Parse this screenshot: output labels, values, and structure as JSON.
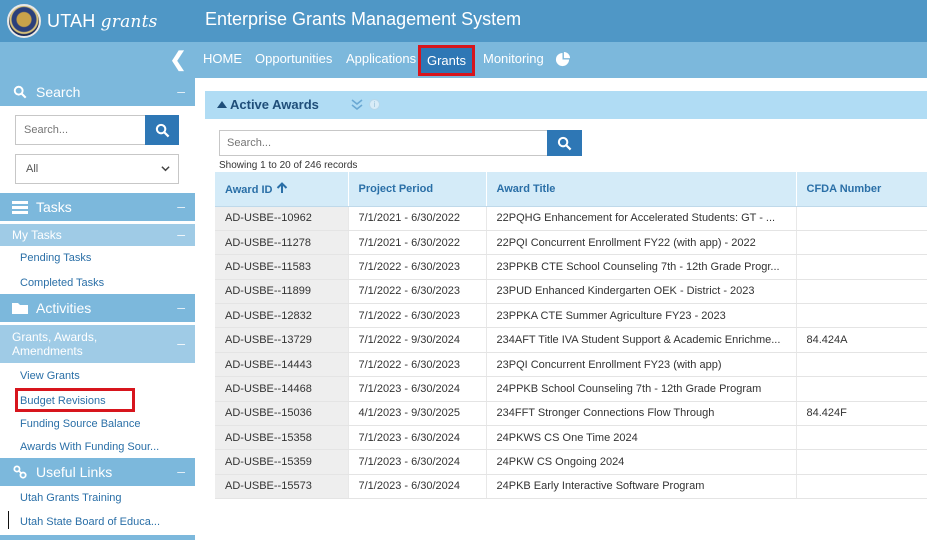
{
  "brand": {
    "logo_text_plain": "UTAH",
    "logo_text_italic": "grants"
  },
  "app_title": "Enterprise Grants Management System",
  "nav": {
    "items": [
      "HOME",
      "Opportunities",
      "Applications",
      "Grants",
      "Monitoring"
    ],
    "active": "Grants"
  },
  "sidebar": {
    "search_title": "Search",
    "search_placeholder": "Search...",
    "select_value": "All",
    "tasks_title": "Tasks",
    "my_tasks": "My Tasks",
    "task_links": [
      "Pending Tasks",
      "Completed Tasks"
    ],
    "activities_title": "Activities",
    "activities_sub": "Grants, Awards, Amendments",
    "activity_links": [
      "View Grants",
      "Budget Revisions",
      "Funding Source Balance",
      "Awards With Funding Sour..."
    ],
    "useful_title": "Useful Links",
    "useful_links": [
      "Utah Grants Training",
      "Utah State Board of Educa..."
    ]
  },
  "awards": {
    "title": "Active Awards",
    "search_placeholder": "Search...",
    "showing": "Showing 1 to 20 of 246 records",
    "columns": [
      "Award ID",
      "Project Period",
      "Award Title",
      "CFDA Number"
    ],
    "rows": [
      [
        "AD-USBE--10962",
        "7/1/2021 - 6/30/2022",
        "22PQHG Enhancement for Accelerated Students: GT - ...",
        ""
      ],
      [
        "AD-USBE--11278",
        "7/1/2021 - 6/30/2022",
        "22PQI Concurrent Enrollment FY22 (with app) - 2022",
        ""
      ],
      [
        "AD-USBE--11583",
        "7/1/2022 - 6/30/2023",
        "23PPKB CTE School Counseling 7th - 12th Grade Progr...",
        ""
      ],
      [
        "AD-USBE--11899",
        "7/1/2022 - 6/30/2023",
        "23PUD Enhanced Kindergarten OEK - District - 2023",
        ""
      ],
      [
        "AD-USBE--12832",
        "7/1/2022 - 6/30/2023",
        "23PPKA CTE Summer Agriculture FY23 - 2023",
        ""
      ],
      [
        "AD-USBE--13729",
        "7/1/2022 - 9/30/2024",
        "234AFT Title IVA Student Support & Academic Enrichme...",
        "84.424A"
      ],
      [
        "AD-USBE--14443",
        "7/1/2022 - 6/30/2023",
        "23PQI Concurrent Enrollment FY23 (with app)",
        ""
      ],
      [
        "AD-USBE--14468",
        "7/1/2023 - 6/30/2024",
        "24PPKB School Counseling 7th - 12th Grade Program",
        ""
      ],
      [
        "AD-USBE--15036",
        "4/1/2023 - 9/30/2025",
        "234FFT Stronger Connections Flow Through",
        "84.424F"
      ],
      [
        "AD-USBE--15358",
        "7/1/2023 - 6/30/2024",
        "24PKWS CS One Time 2024",
        ""
      ],
      [
        "AD-USBE--15359",
        "7/1/2023 - 6/30/2024",
        "24PKW CS Ongoing 2024",
        ""
      ],
      [
        "AD-USBE--15573",
        "7/1/2023 - 6/30/2024",
        "24PKB Early Interactive Software Program",
        ""
      ]
    ]
  },
  "colors": {
    "topbar": "#4f97c6",
    "navbar": "#7cb8dc",
    "highlight_border": "#d7151d",
    "link": "#2a6fa7",
    "button": "#2e77b5"
  }
}
